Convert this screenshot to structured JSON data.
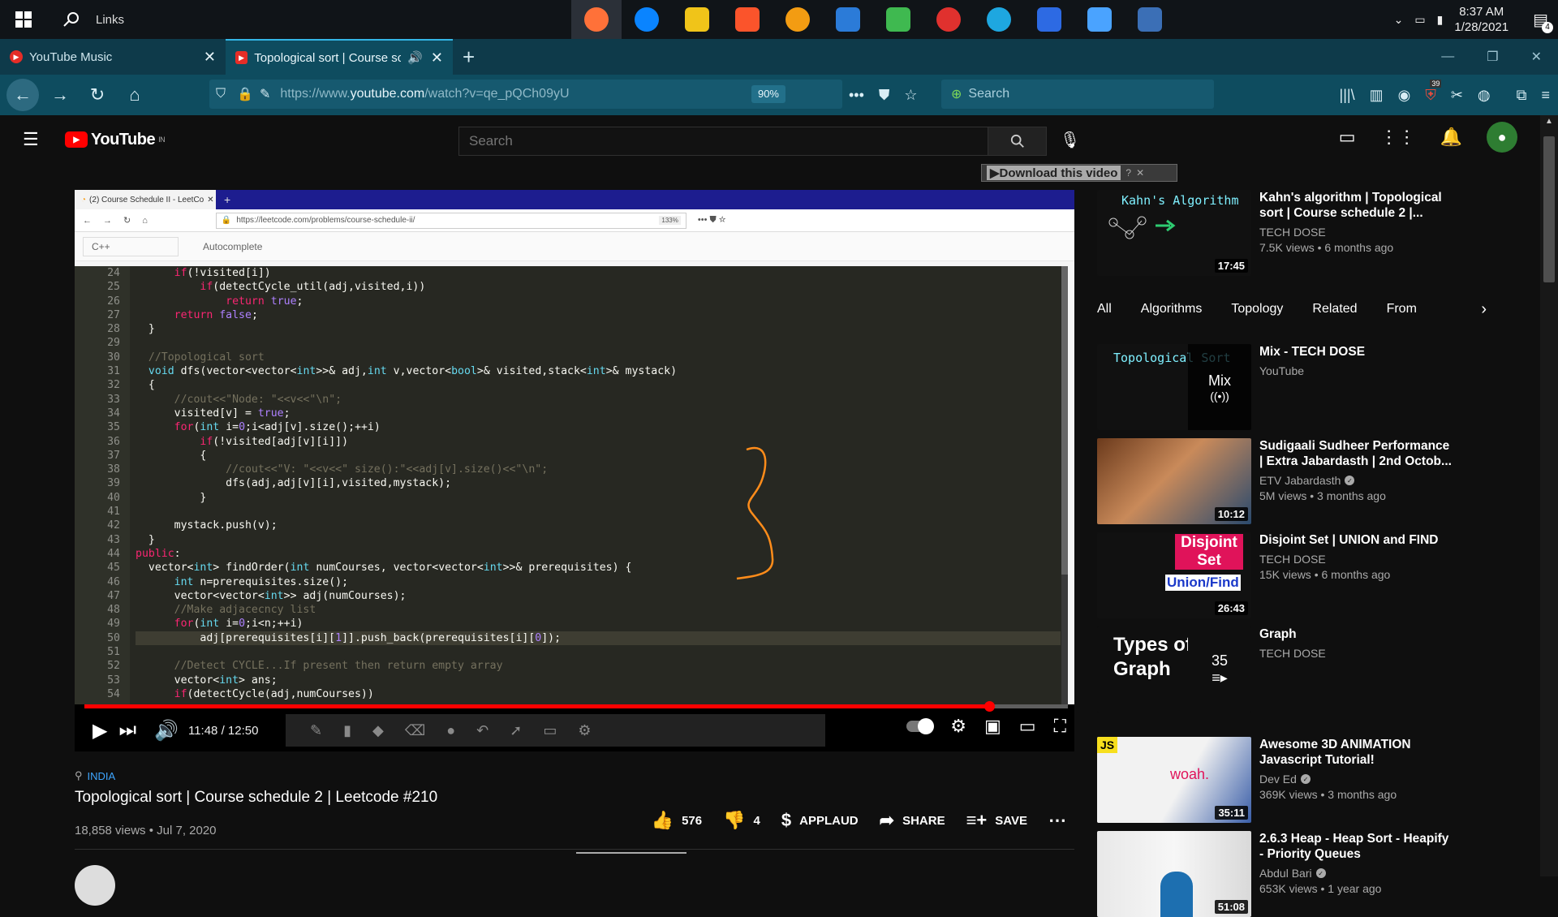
{
  "taskbar": {
    "links_label": "Links",
    "clock_time": "8:37 AM",
    "clock_date": "1/28/2021",
    "notification_count": "4",
    "app_colors": [
      "#ff7139",
      "#0a84ff",
      "#f0c419",
      "#fb542b",
      "#f39c12",
      "#2b7bd8",
      "#3fb950",
      "#e0312e",
      "#1ea7e0",
      "#2d6ae3",
      "#4aa3ff",
      "#3b6fb6"
    ]
  },
  "browser": {
    "tabs": [
      {
        "label": "YouTube Music"
      },
      {
        "label": "Topological sort | Course sc"
      }
    ],
    "url_prefix": "https://www.",
    "url_host": "youtube.com",
    "url_path": "/watch?v=qe_pQCh09yU",
    "zoom": "90%",
    "search_placeholder": "Search",
    "badge_count": "39"
  },
  "youtube": {
    "logo_text": "YouTube",
    "logo_region": "IN",
    "search_placeholder": "Search",
    "download_label": "Download this video",
    "video": {
      "location": "INDIA",
      "title": "Topological sort | Course schedule 2 | Leetcode #210",
      "views_date": "18,858 views • Jul 7, 2020",
      "current_time": "11:48",
      "duration": "12:50",
      "progress_fraction": 0.92,
      "likes": "576",
      "dislikes": "4",
      "applaud": "APPLAUD",
      "share": "SHARE",
      "save": "SAVE"
    },
    "inner_browser": {
      "tab_label": "(2) Course Schedule II - LeetCo",
      "url": "https://leetcode.com/problems/course-schedule-ii/",
      "zoom": "133%",
      "language": "C++",
      "autocomplete": "Autocomplete",
      "line_numbers": [
        "24",
        "25",
        "26",
        "27",
        "28",
        "29",
        "30",
        "31",
        "32",
        "33",
        "34",
        "35",
        "36",
        "37",
        "38",
        "39",
        "40",
        "41",
        "42",
        "43",
        "44",
        "45",
        "46",
        "47",
        "48",
        "49",
        "50",
        "51",
        "52",
        "53",
        "54"
      ]
    },
    "chips": [
      "All",
      "Algorithms",
      "Topology",
      "Related",
      "From"
    ],
    "recommendations": [
      {
        "title": "Kahn's algorithm | Topological sort | Course schedule 2 |...",
        "channel": "TECH DOSE",
        "stats": "7.5K views • 6 months ago",
        "duration": "17:45",
        "thumb_text": "Kahn's Algorithm"
      },
      {
        "title": "Mix - TECH DOSE",
        "channel": "YouTube",
        "stats": "",
        "duration": "",
        "thumb_text": "Topological Sort",
        "mix_label": "Mix"
      },
      {
        "title": "Sudigaali Sudheer Performance | Extra Jabardasth | 2nd Octob...",
        "channel": "ETV Jabardasth",
        "stats": "5M views • 3 months ago",
        "duration": "10:12"
      },
      {
        "title": "Disjoint Set | UNION and FIND",
        "channel": "TECH DOSE",
        "stats": "15K views • 6 months ago",
        "duration": "26:43",
        "thumb_text": "Disjoint Set",
        "thumb_sub": "Union/Find"
      },
      {
        "title": "Graph",
        "channel": "TECH DOSE",
        "stats": "",
        "duration": "",
        "thumb_text": "Types of Graph",
        "playlist_count": "35"
      },
      {
        "title": "Awesome 3D ANIMATION Javascript Tutorial!",
        "channel": "Dev Ed",
        "stats": "369K views • 3 months ago",
        "duration": "35:11",
        "thumb_text": "woah."
      },
      {
        "title": "2.6.3 Heap - Heap Sort - Heapify - Priority Queues",
        "channel": "Abdul Bari",
        "stats": "653K views • 1 year ago",
        "duration": "51:08"
      }
    ]
  }
}
